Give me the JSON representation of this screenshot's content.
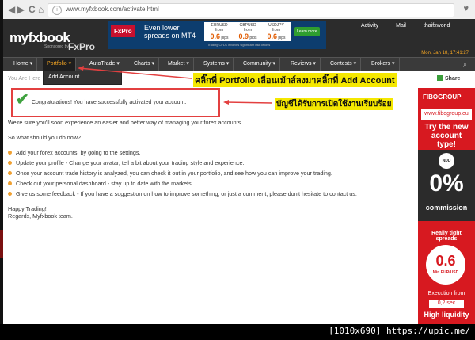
{
  "browser": {
    "back": "◀",
    "forward": "▶",
    "reload": "C",
    "home": "⌂",
    "url": "www.myfxbook.com/activate.html"
  },
  "header": {
    "logo_text": "myfxbook",
    "sponsored_by": "Sponsored by",
    "sponsor": "FxPro",
    "banner": {
      "brand": "FxPro",
      "slogan": "Even lower spreads on MT4",
      "quotes": [
        {
          "pair": "EURUSD",
          "from": "from",
          "pips": "0.6",
          "unit": "pips"
        },
        {
          "pair": "GBPUSD",
          "from": "from",
          "pips": "0.9",
          "unit": "pips"
        },
        {
          "pair": "USDJPY",
          "from": "from",
          "pips": "0.6",
          "unit": "pips"
        }
      ],
      "cta": "Learn more",
      "disclaimer": "Trading CFDs involves significant risk of loss"
    },
    "links": {
      "activity": "Activity",
      "mail": "Mail",
      "user": "thaifxworld"
    },
    "date": "Mon, Jan 18, 17:41:27"
  },
  "menu": {
    "items": [
      {
        "label": "Home ▾"
      },
      {
        "label": "Portfolio ▾"
      },
      {
        "label": "AutoTrade ▾"
      },
      {
        "label": "Charts ▾"
      },
      {
        "label": "Market ▾"
      },
      {
        "label": "Systems ▾"
      },
      {
        "label": "Community ▾"
      },
      {
        "label": "Reviews ▾"
      },
      {
        "label": "Contests ▾"
      },
      {
        "label": "Brokers ▾"
      }
    ],
    "dropdown_item": "Add Account.."
  },
  "breadcrumb": "You Are Here",
  "share": "Share",
  "annotations": {
    "portfolio_hint": "คลิ๊กที่ Portfolio เลื่อนเม้าส์ลงมาคลิ๊กที่ Add Account",
    "activated_hint": "บัญชีได้รับการเปิดใช้งานเรียบร้อย"
  },
  "success_message": "Congratulations! You have successfully activated your account.",
  "content": {
    "intro": "We're sure you'll soon experience an easier and better way of managing your forex accounts.",
    "question": "So what should you do now?",
    "steps": [
      "Add your forex accounts, by going to the settings.",
      "Update your profile - Change your avatar, tell a bit about your trading style and experience.",
      "Once your account trade history is analyzed, you can check it out in your portfolio, and see how you can improve your trading.",
      "Check out your personal dashboard - stay up to date with the markets.",
      "Give us some feedback - If you have a suggestion on how to improve something, or just a comment, please don't hesitate to contact us."
    ],
    "closing": "Happy Trading!",
    "signoff": "Regards, Myfxbook team."
  },
  "ad": {
    "brand": "FIBOGROUP",
    "site": "www.fibogroup.eu",
    "headline": "Try the new account type!",
    "badge": "NDD",
    "zero": "0%",
    "commission": "commission",
    "tight": "Really tight spreads",
    "spread": "0.6",
    "spread_unit": "Min EUR/USD",
    "execution": "Execution from",
    "exec_time": "0,2 sec",
    "liquidity": "High liquidity"
  },
  "footer": "[1010x690] https://upic.me/",
  "colors": {
    "accent": "#f5a623",
    "annotation_bg": "#f5e800",
    "arrow": "#e34040",
    "ad_red": "#d71920"
  }
}
